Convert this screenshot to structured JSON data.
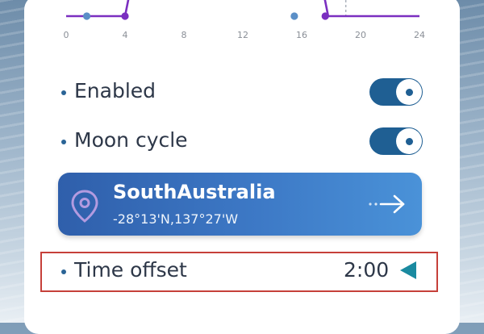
{
  "chart_data": {
    "type": "line",
    "x_ticks": [
      "0",
      "4",
      "8",
      "12",
      "16",
      "20",
      "24"
    ],
    "xlim": [
      0,
      24
    ],
    "series": [
      {
        "points": [
          [
            0,
            1
          ],
          [
            4,
            1
          ],
          [
            4.3,
            1.25
          ]
        ]
      },
      {
        "points": [
          [
            17.5,
            1.25
          ],
          [
            17.8,
            1
          ],
          [
            24,
            1
          ]
        ]
      }
    ],
    "markers": [
      {
        "x": 1.4,
        "y": 1,
        "color": "#5b8fc7"
      },
      {
        "x": 4,
        "y": 1,
        "color": "#7b2fc0"
      },
      {
        "x": 15.5,
        "y": 1,
        "color": "#5b8fc7"
      },
      {
        "x": 17.6,
        "y": 1,
        "color": "#7b2fc0"
      }
    ],
    "dashed_marker_x": 19
  },
  "settings": {
    "enabled_label": "Enabled",
    "enabled_on": true,
    "moon_cycle_label": "Moon cycle",
    "moon_cycle_on": true
  },
  "location": {
    "name": "SouthAustralia",
    "coords": "-28°13'N,137°27'W"
  },
  "time_offset": {
    "label": "Time offset",
    "value": "2:00"
  },
  "colors": {
    "accent": "#1f5f93",
    "line": "#7b2fc0",
    "highlight": "#c6403a"
  }
}
